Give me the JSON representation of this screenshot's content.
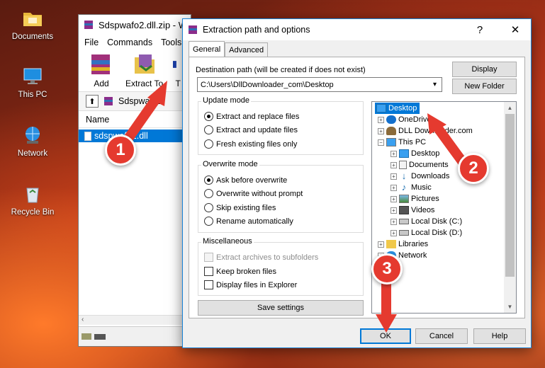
{
  "desktop": {
    "icons": [
      {
        "label": "Documents",
        "icon": "folder-icon"
      },
      {
        "label": "This PC",
        "icon": "computer-icon"
      },
      {
        "label": "Network",
        "icon": "network-icon"
      },
      {
        "label": "Recycle Bin",
        "icon": "recycle-bin-icon"
      }
    ]
  },
  "winrar": {
    "title": "Sdspwafo2.dll.zip - W",
    "menu": [
      "File",
      "Commands",
      "Tools"
    ],
    "toolbar": {
      "add": "Add",
      "extract_to": "Extract To",
      "third": "T"
    },
    "address": "Sdspwafo2",
    "column_name": "Name",
    "file_row": "sdspwafo2.dll"
  },
  "dialog": {
    "title": "Extraction path and options",
    "help": "?",
    "close": "✕",
    "tabs": [
      "General",
      "Advanced"
    ],
    "destination_label": "Destination path (will be created if does not exist)",
    "destination_value": "C:\\Users\\DllDownloader_com\\Desktop",
    "display_button": "Display",
    "new_folder_button": "New Folder",
    "update_mode": {
      "title": "Update mode",
      "options": [
        "Extract and replace files",
        "Extract and update files",
        "Fresh existing files only"
      ],
      "selected": 0
    },
    "overwrite_mode": {
      "title": "Overwrite mode",
      "options": [
        "Ask before overwrite",
        "Overwrite without prompt",
        "Skip existing files",
        "Rename automatically"
      ],
      "selected": 0
    },
    "misc": {
      "title": "Miscellaneous",
      "options": [
        "Extract archives to subfolders",
        "Keep broken files",
        "Display files in Explorer"
      ]
    },
    "save_settings": "Save settings",
    "tree": [
      {
        "label": "Desktop",
        "selected": true
      },
      {
        "label": "OneDrive"
      },
      {
        "label": "DLL Downloader.com"
      },
      {
        "label": "This PC"
      },
      {
        "label": "Desktop"
      },
      {
        "label": "Documents"
      },
      {
        "label": "Downloads"
      },
      {
        "label": "Music"
      },
      {
        "label": "Pictures"
      },
      {
        "label": "Videos"
      },
      {
        "label": "Local Disk (C:)"
      },
      {
        "label": "Local Disk (D:)"
      },
      {
        "label": "Libraries"
      },
      {
        "label": "Network"
      }
    ],
    "ok": "OK",
    "cancel": "Cancel",
    "help_button": "Help"
  },
  "annotations": {
    "step1": "1",
    "step2": "2",
    "step3": "3"
  },
  "colors": {
    "selection": "#0078d7",
    "annotation": "#e53a2f"
  }
}
